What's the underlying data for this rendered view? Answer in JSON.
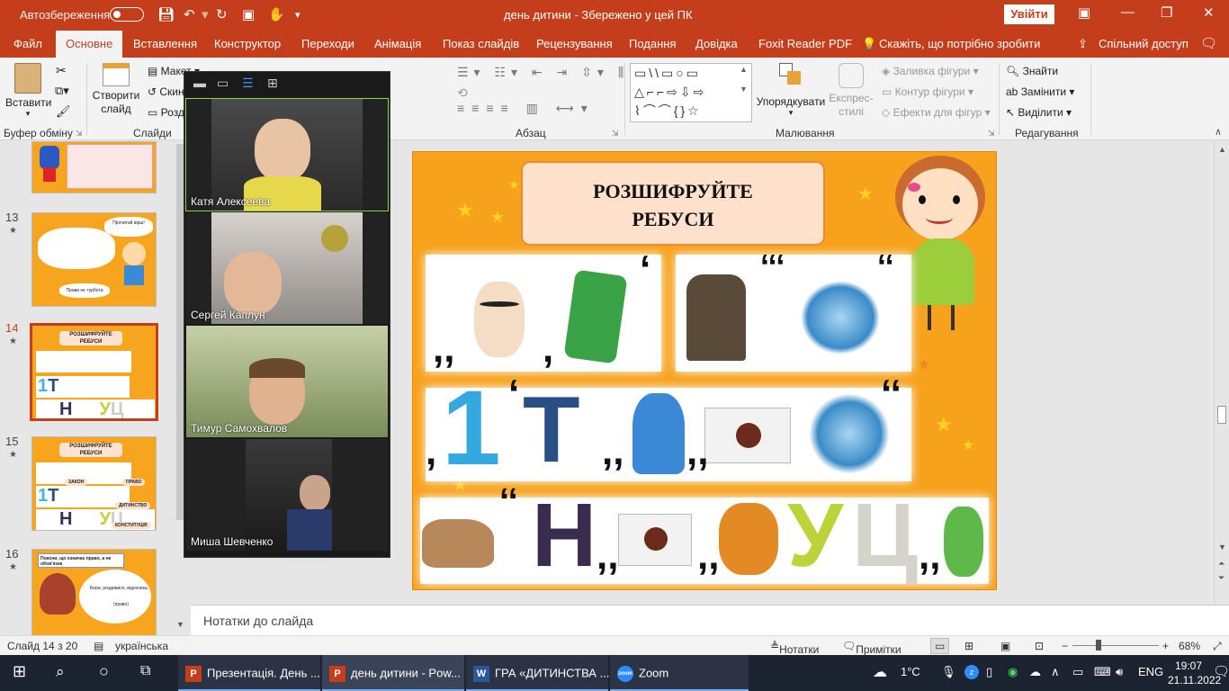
{
  "titlebar": {
    "autosave": "Автозбереження",
    "document_title": "день дитини  -  Збережено у цей ПК",
    "signin": "Увійти"
  },
  "tabs": [
    "Файл",
    "Основне",
    "Вставлення",
    "Конструктор",
    "Переходи",
    "Анімація",
    "Показ слайдів",
    "Рецензування",
    "Подання",
    "Довідка",
    "Foxit Reader PDF"
  ],
  "tell_me": "Скажіть, що потрібно зробити",
  "share": "Спільний доступ",
  "ribbon": {
    "paste": "Вставити",
    "new_slide": "Створити слайд",
    "layout": "Макет",
    "reset": "Скин",
    "section": "Розд",
    "group_clipboard": "Буфер обміну",
    "group_slides": "Слайди",
    "group_paragraph": "Абзац",
    "group_drawing": "Малювання",
    "group_editing": "Редагування",
    "arrange": "Упорядкувати",
    "quick_styles": "Експрес-стилі",
    "shape_fill": "Заливка фігури",
    "shape_outline": "Контур фігури",
    "shape_effects": "Ефекти для фігур",
    "find": "Знайти",
    "replace": "Замінити",
    "select": "Виділити"
  },
  "thumbnails": [
    {
      "num": "13",
      "line1": "Прочитай вірш!",
      "line2": "Права не турбота"
    },
    {
      "num": "14",
      "title": "РОЗШИФРУЙТЕ РЕБУСИ"
    },
    {
      "num": "15",
      "title": "РОЗШИФРУЙТЕ РЕБУСИ",
      "l1": "ЗАКОН",
      "l2": "ПРАВО",
      "l3": "ДИТИНСТВО",
      "l4": "КОНСТИТУЦІЯ"
    },
    {
      "num": "16",
      "line1": "Поясни, що означає право, а не обов'язок",
      "line2": "Бери, роздивися, відпочинь",
      "line3": "(право)"
    }
  ],
  "zoom_participants": [
    {
      "name": "Катя Алексеева"
    },
    {
      "name": "Сергей Каплун"
    },
    {
      "name": "Тимур Самохвалов"
    },
    {
      "name": "Миша Шевченко"
    }
  ],
  "slide": {
    "title_line1": "РОЗШИФРУЙТЕ",
    "title_line2": "РЕБУСИ",
    "row2_letters": [
      "1",
      "Т"
    ],
    "row3_letters": [
      "Н",
      "У",
      "Ц"
    ]
  },
  "notes_placeholder": "Нотатки до слайда",
  "status": {
    "slide_count": "Слайд 14 з 20",
    "language": "українська",
    "notes": "Нотатки",
    "comments": "Примітки",
    "zoom": "68%"
  },
  "taskbar": {
    "items": [
      "Презентація. День ...",
      "день дитини - Pow...",
      "ГРА «ДИТИНСТВА ...",
      "Zoom"
    ],
    "temp": "1°C",
    "lang": "ENG",
    "time": "19:07",
    "date": "21.11.2022"
  },
  "colors": {
    "accent": "#c43e1c",
    "slide_bg": "#f7a21d",
    "taskbar": "#1c2331"
  }
}
